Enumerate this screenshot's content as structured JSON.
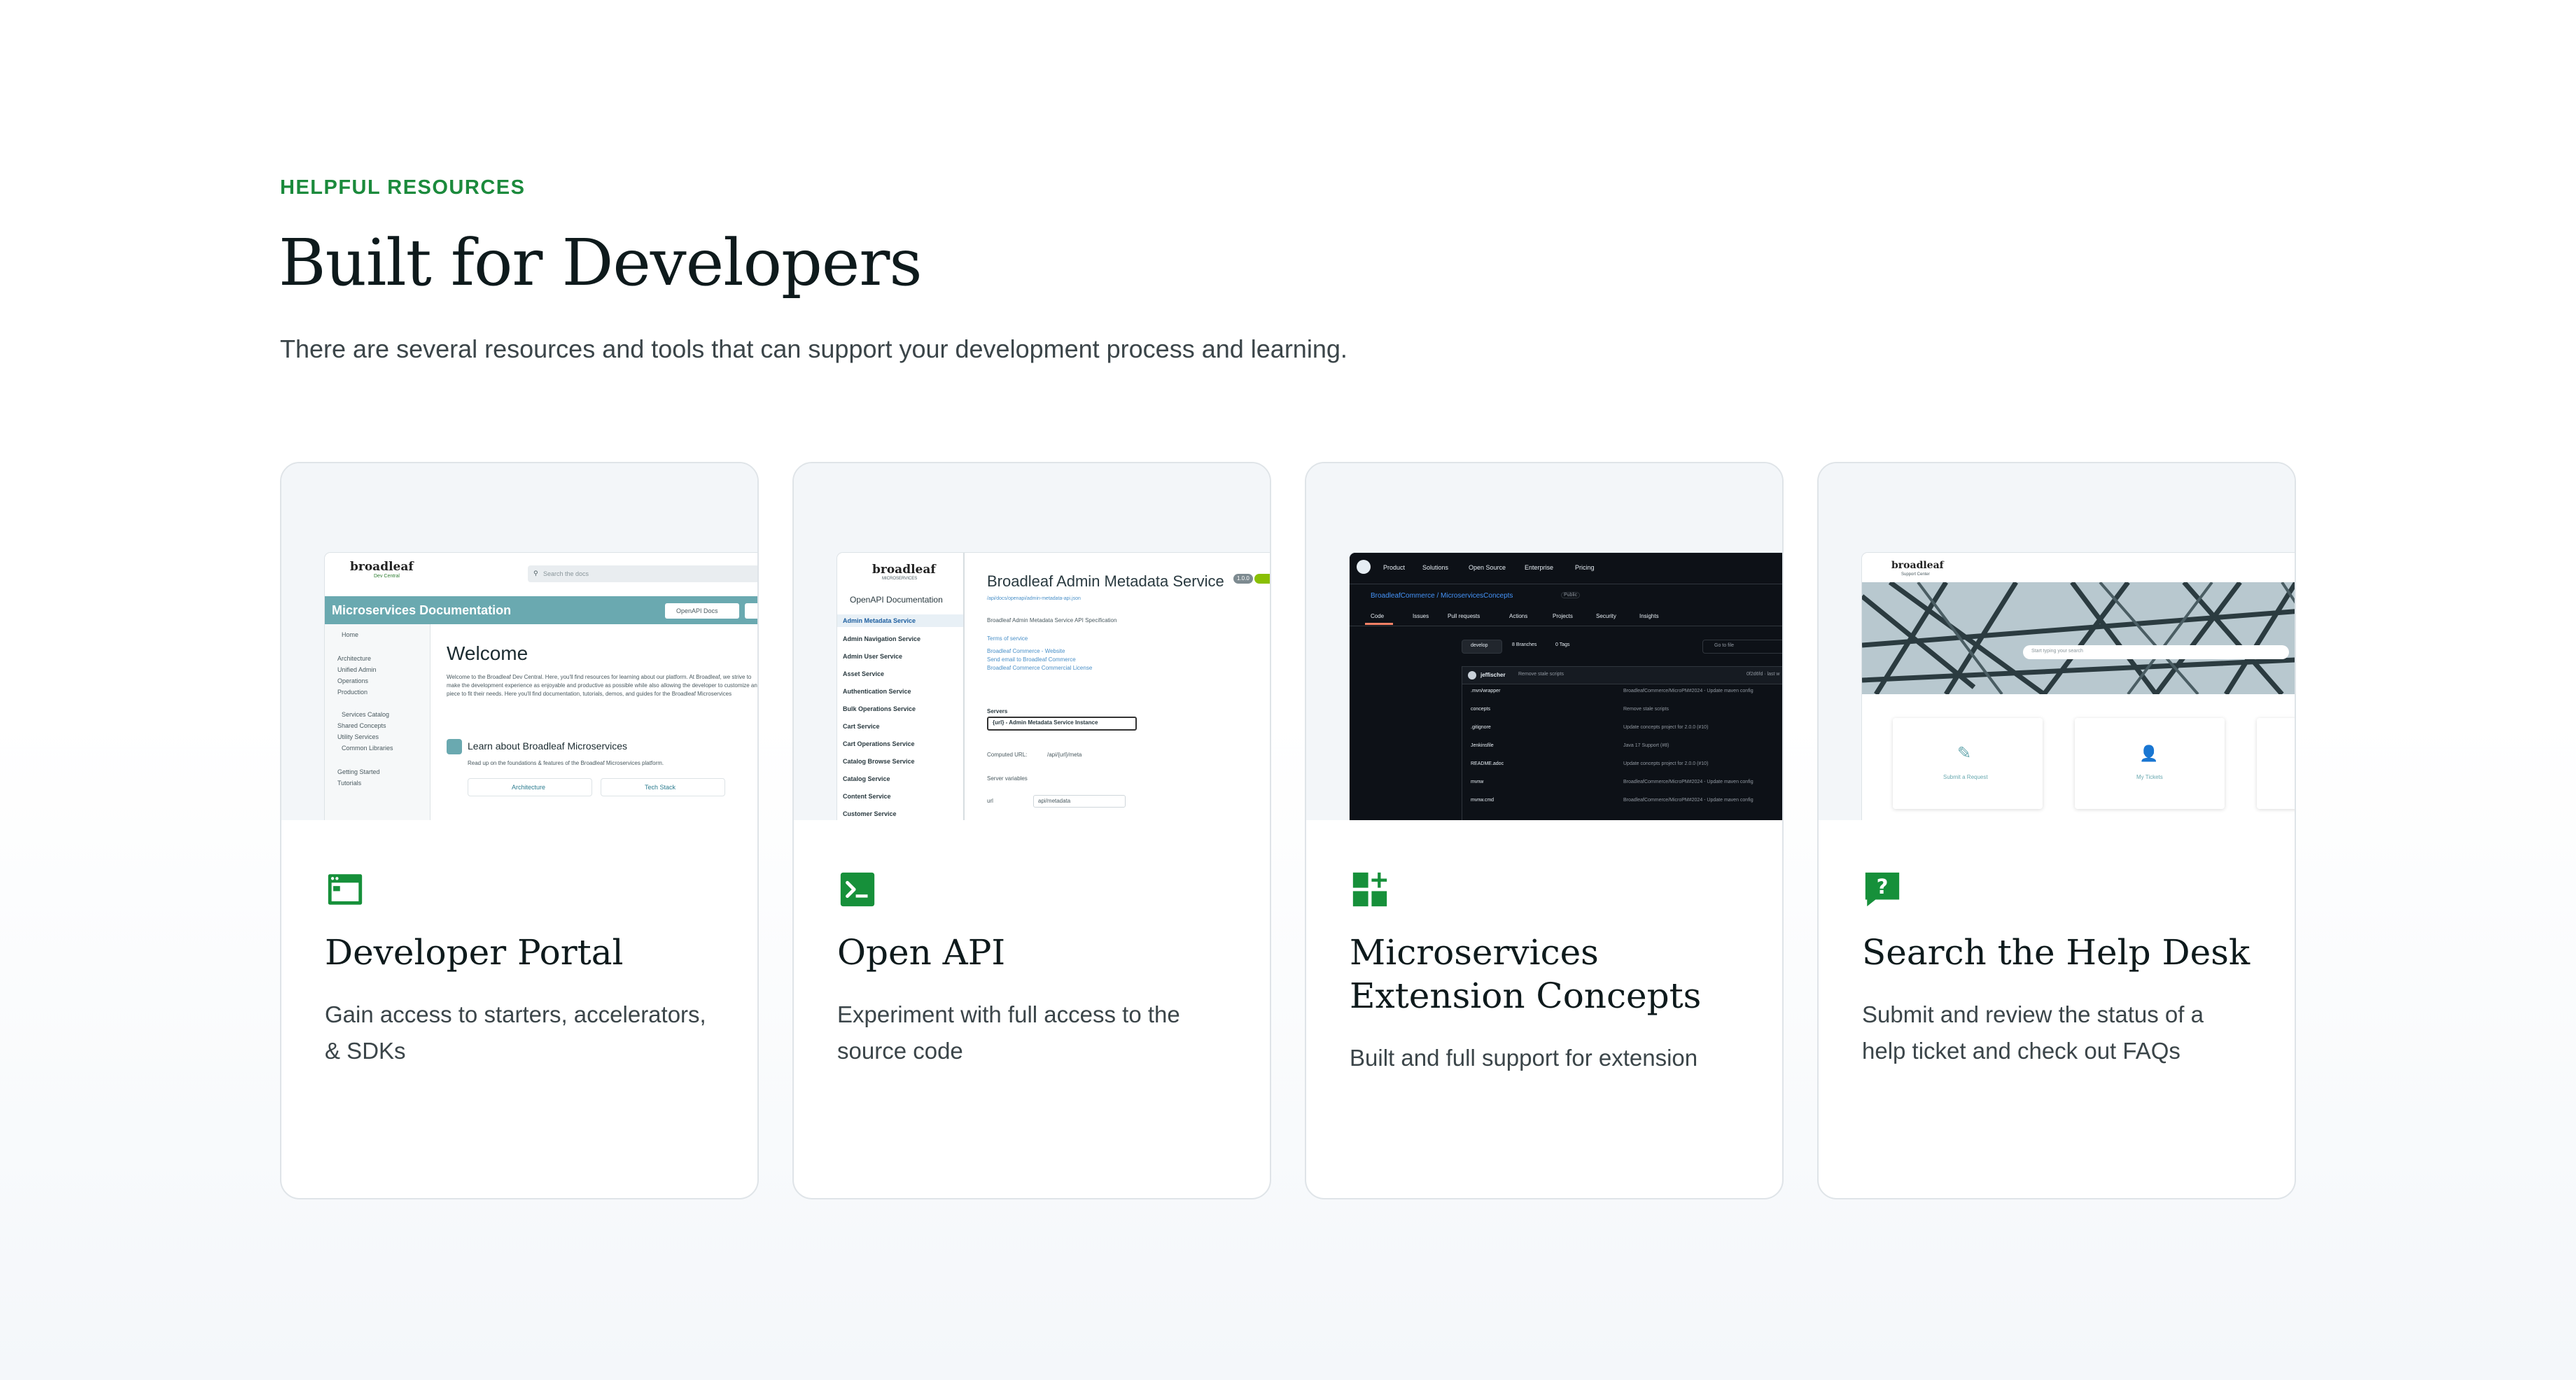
{
  "section": {
    "eyebrow": "HELPFUL RESOURCES",
    "title": "Built for Developers",
    "subtitle": "There are several resources and tools that can support your development process and learning."
  },
  "cards": [
    {
      "title": "Developer Portal",
      "description": "Gain access to starters, accelerators, & SDKs",
      "icon": "browser-window-icon",
      "preview": {
        "logo": "broadleaf",
        "logo_sub": "Dev Central",
        "search_placeholder": "Search the docs",
        "banner": "Microservices Documentation",
        "banner_button": "OpenAPI Docs",
        "nav": [
          "Home",
          "Architecture",
          "Unified Admin",
          "Operations",
          "Production",
          "Services Catalog",
          "Shared Concepts",
          "Utility Services",
          "Common Libraries",
          "Getting Started",
          "Tutorials"
        ],
        "heading": "Welcome",
        "body": "Welcome to the Broadleaf Dev Central. Here, you'll find resources for learning about our platform. At Broadleaf, we strive to make the development experience as enjoyable and productive as possible while also allowing the developer to customize any piece to fit their needs. Here you'll find documentation, tutorials, demos, and guides for the Broadleaf Microservices",
        "learn": "Learn about Broadleaf Microservices",
        "learn_sub": "Read up on the foundations & features of the Broadleaf Microservices platform.",
        "links": [
          "Architecture",
          "Tech Stack"
        ]
      }
    },
    {
      "title": "Open API",
      "description": "Experiment with full access to the source code",
      "icon": "terminal-icon",
      "preview": {
        "logo": "broadleaf",
        "logo_sub": "MICROSERVICES",
        "side_title": "OpenAPI Documentation",
        "nav": [
          "Admin Metadata Service",
          "Admin Navigation Service",
          "Admin User Service",
          "Asset Service",
          "Authentication Service",
          "Bulk Operations Service",
          "Cart Service",
          "Cart Operations Service",
          "Catalog Browse Service",
          "Catalog Service",
          "Content Service",
          "Customer Service"
        ],
        "heading": "Broadleaf Admin Metadata Service",
        "version": "1.0.0",
        "spec_link": "/api/docs/openapi/admin-metadata-api.json",
        "spec": "Broadleaf Admin Metadata Service API Specification",
        "links": [
          "Terms of service",
          "Broadleaf Commerce - Website",
          "Send email to Broadleaf Commerce",
          "Broadleaf Commerce Commercial License"
        ],
        "servers_label": "Servers",
        "server_select": "{url} - Admin Metadata Service Instance",
        "computed_label": "Computed URL:",
        "computed_value": "/api/{url}/meta",
        "vars_label": "Server variables",
        "var_name": "url",
        "var_value": "api/metadata"
      }
    },
    {
      "title": "Microservices Extension Concepts",
      "description": "Built and full support for extension",
      "icon": "apps-add-icon",
      "preview": {
        "menu": [
          "Product",
          "Solutions",
          "Open Source",
          "Enterprise",
          "Pricing"
        ],
        "repo": "BroadleafCommerce / MicroservicesConcepts",
        "visibility": "Public",
        "tabs": [
          "Code",
          "Issues",
          "Pull requests",
          "Actions",
          "Projects",
          "Security",
          "Insights"
        ],
        "branch": "develop",
        "branches": "8 Branches",
        "tags": "0 Tags",
        "goto": "Go to file",
        "commit_user": "jeffischer",
        "commit_msg": "Remove stale scripts",
        "commit_hash": "0f2d6fd · last w",
        "files": [
          {
            "name": ".mvn/wrapper",
            "msg": "BroadleafCommerce/MicroPM#2024 - Update maven config"
          },
          {
            "name": "concepts",
            "msg": "Remove stale scripts"
          },
          {
            "name": ".gitignore",
            "msg": "Update concepts project for 2.0.0 (#10)"
          },
          {
            "name": "Jenkinsfile",
            "msg": "Java 17 Support (#8)"
          },
          {
            "name": "README.adoc",
            "msg": "Update concepts project for 2.0.0 (#10)"
          },
          {
            "name": "mvnw",
            "msg": "BroadleafCommerce/MicroPM#2024 - Update maven config"
          },
          {
            "name": "mvnw.cmd",
            "msg": "BroadleafCommerce/MicroPM#2024 - Update maven config"
          }
        ]
      }
    },
    {
      "title": "Search the Help Desk",
      "description": "Submit and review the status of a help ticket and check out FAQs",
      "icon": "help-chat-icon",
      "preview": {
        "logo": "broadleaf",
        "logo_sub": "Support Center",
        "search_placeholder": "Start typing your search",
        "tiles": [
          "Submit a Request",
          "My Tickets"
        ]
      }
    }
  ],
  "colors": {
    "accent_green": "#1b8a3c",
    "icon_green": "#16903a",
    "banner_teal": "#6aa9b0",
    "card_border": "#dfe4e8"
  }
}
